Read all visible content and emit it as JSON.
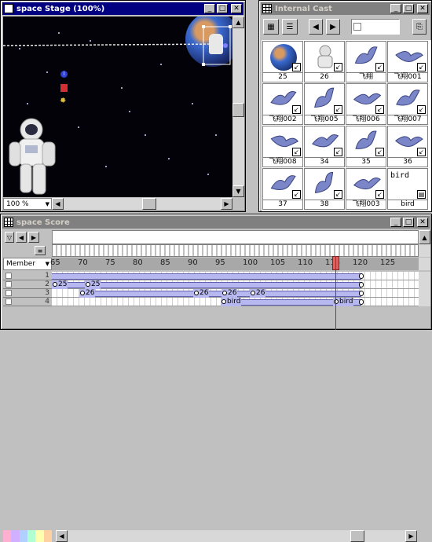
{
  "stage": {
    "title": "space Stage (100%)",
    "zoom": "100 %"
  },
  "cast": {
    "title": "Internal Cast",
    "members": [
      {
        "label": "25",
        "kind": "earth"
      },
      {
        "label": "26",
        "kind": "astronaut"
      },
      {
        "label": "飞翔",
        "kind": "bird"
      },
      {
        "label": "飞翔001",
        "kind": "bird"
      },
      {
        "label": "飞翔002",
        "kind": "bird"
      },
      {
        "label": "飞翔005",
        "kind": "bird"
      },
      {
        "label": "飞翔006",
        "kind": "bird"
      },
      {
        "label": "飞翔007",
        "kind": "bird"
      },
      {
        "label": "飞翔008",
        "kind": "bird"
      },
      {
        "label": "34",
        "kind": "bird"
      },
      {
        "label": "35",
        "kind": "bird"
      },
      {
        "label": "36",
        "kind": "bird"
      },
      {
        "label": "37",
        "kind": "bird"
      },
      {
        "label": "38",
        "kind": "bird"
      },
      {
        "label": "飞翔003",
        "kind": "bird"
      },
      {
        "label": "bird",
        "kind": "text",
        "text": "bird"
      }
    ]
  },
  "score": {
    "title": "space Score",
    "member_select": "Member",
    "ruler_ticks": [
      "65",
      "70",
      "75",
      "80",
      "85",
      "90",
      "95",
      "100",
      "105",
      "110",
      "115",
      "120",
      "125"
    ],
    "channels": [
      {
        "num": "1"
      },
      {
        "num": "2",
        "keys": [
          "25",
          "25"
        ]
      },
      {
        "num": "3",
        "keys": [
          "26",
          "26",
          "26",
          "26"
        ]
      },
      {
        "num": "4",
        "keys": [
          "bird",
          "bird"
        ]
      }
    ]
  },
  "colors": {
    "active_title": "#000080",
    "inactive_title": "#808080",
    "sprite_span": "#b8b8f0",
    "playhead": "#c02020"
  }
}
